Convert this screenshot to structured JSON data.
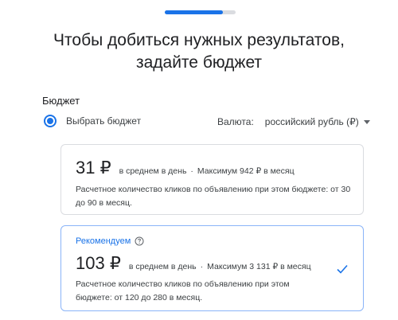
{
  "progress": {
    "fraction": 0.82
  },
  "heading": {
    "line1": "Чтобы добиться нужных результатов,",
    "line2": "задайте бюджет"
  },
  "budget_section": {
    "label": "Бюджет",
    "radio_label": "Выбрать бюджет",
    "currency_label": "Валюта:",
    "currency_value": "российский рубль (₽)"
  },
  "options": [
    {
      "price": "31 ₽",
      "per_day": "в среднем в день",
      "separator": "·",
      "max": "Максимум 942 ₽ в месяц",
      "description": "Расчетное количество кликов по объявлению при этом бюджете: от 30 до 90 в месяц."
    },
    {
      "badge": "Рекомендуем",
      "price": "103 ₽",
      "per_day": "в среднем в день",
      "separator": "·",
      "max": "Максимум 3 131 ₽ в месяц",
      "description": "Расчетное количество кликов по объявлению при этом бюджете: от 120 до 280 в месяц.",
      "selected": true
    }
  ],
  "icons": {
    "help": "help-circle-icon",
    "check": "checkmark-icon",
    "caret": "dropdown-caret-icon"
  },
  "colors": {
    "accent": "#1a73e8",
    "text": "#202124",
    "border": "#dadce0"
  }
}
